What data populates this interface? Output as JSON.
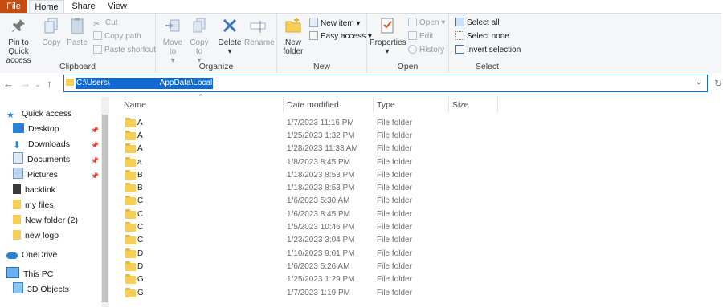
{
  "tabs": {
    "file": "File",
    "home": "Home",
    "share": "Share",
    "view": "View"
  },
  "clipboard": {
    "pin": "Pin to Quick access",
    "copy": "Copy",
    "paste": "Paste",
    "cut": "Cut",
    "copy_path": "Copy path",
    "paste_shortcut": "Paste shortcut",
    "label": "Clipboard"
  },
  "organize": {
    "move_to": "Move to",
    "copy_to": "Copy to",
    "delete": "Delete",
    "rename": "Rename",
    "label": "Organize"
  },
  "new_group": {
    "new_folder": "New folder",
    "new_item": "New item",
    "easy_access": "Easy access",
    "label": "New"
  },
  "open_group": {
    "properties": "Properties",
    "open": "Open",
    "edit": "Edit",
    "history": "History",
    "label": "Open"
  },
  "select_group": {
    "select_all": "Select all",
    "select_none": "Select none",
    "invert": "Invert selection",
    "label": "Select"
  },
  "address": {
    "part1": "C:\\Users\\",
    "part2": "AppData\\Local"
  },
  "nav": {
    "quick_access": "Quick access",
    "desktop": "Desktop",
    "downloads": "Downloads",
    "documents": "Documents",
    "pictures": "Pictures",
    "backlink": "backlink",
    "my_files": "my files",
    "new_folder_2": "New folder (2)",
    "new_logo": "new logo",
    "onedrive": "OneDrive",
    "this_pc": "This PC",
    "objects3d": "3D Objects"
  },
  "columns": {
    "name": "Name",
    "date": "Date modified",
    "type": "Type",
    "size": "Size"
  },
  "files": [
    {
      "name": "A",
      "date": "1/7/2023 11:16 PM",
      "type": "File folder"
    },
    {
      "name": "A",
      "date": "1/25/2023 1:32 PM",
      "type": "File folder"
    },
    {
      "name": "A",
      "date": "1/28/2023 11:33 AM",
      "type": "File folder"
    },
    {
      "name": "a",
      "date": "1/8/2023 8:45 PM",
      "type": "File folder"
    },
    {
      "name": "B",
      "date": "1/18/2023 8:53 PM",
      "type": "File folder"
    },
    {
      "name": "B",
      "date": "1/18/2023 8:53 PM",
      "type": "File folder"
    },
    {
      "name": "C",
      "date": "1/6/2023 5:30 AM",
      "type": "File folder"
    },
    {
      "name": "C",
      "date": "1/6/2023 8:45 PM",
      "type": "File folder"
    },
    {
      "name": "C",
      "date": "1/5/2023 10:46 PM",
      "type": "File folder"
    },
    {
      "name": "C",
      "date": "1/23/2023 3:04 PM",
      "type": "File folder"
    },
    {
      "name": "D",
      "date": "1/10/2023 9:01 PM",
      "type": "File folder"
    },
    {
      "name": "D",
      "date": "1/6/2023 5:26 AM",
      "type": "File folder"
    },
    {
      "name": "G",
      "date": "1/25/2023 1:29 PM",
      "type": "File folder"
    },
    {
      "name": "G",
      "date": "1/7/2023 1:19 PM",
      "type": "File folder"
    }
  ]
}
